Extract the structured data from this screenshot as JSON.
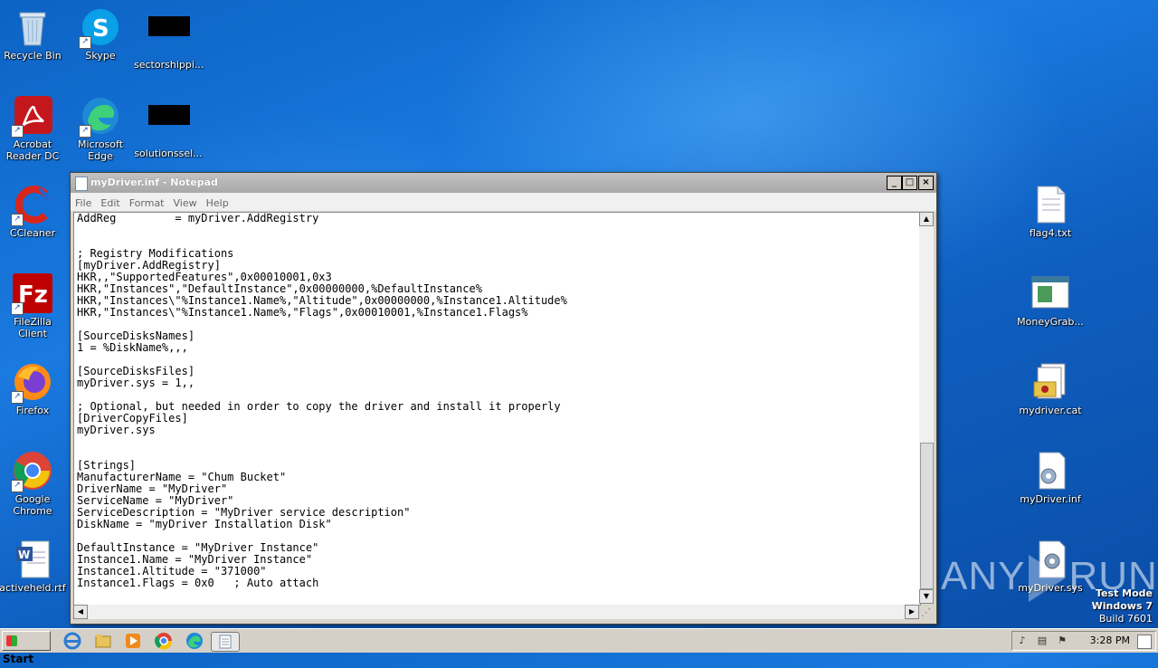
{
  "desktop": {
    "icons": [
      {
        "label": "Recycle Bin"
      },
      {
        "label": "Skype"
      },
      {
        "label": "sectorshippi..."
      },
      {
        "label": "Acrobat Reader DC"
      },
      {
        "label": "Microsoft Edge"
      },
      {
        "label": "solutionssel..."
      },
      {
        "label": "CCleaner"
      },
      {
        "label": "FileZilla Client"
      },
      {
        "label": "Firefox"
      },
      {
        "label": "Google Chrome"
      },
      {
        "label": "activeheld.rtf"
      },
      {
        "label": "flag4.txt"
      },
      {
        "label": "MoneyGrab..."
      },
      {
        "label": "mydriver.cat"
      },
      {
        "label": "myDriver.inf"
      },
      {
        "label": "myDriver.sys"
      }
    ]
  },
  "notepad": {
    "title": "myDriver.inf - Notepad",
    "menu": [
      "File",
      "Edit",
      "Format",
      "View",
      "Help"
    ],
    "content": "AddReg         = myDriver.AddRegistry\n\n\n; Registry Modifications\n[myDriver.AddRegistry]\nHKR,,\"SupportedFeatures\",0x00010001,0x3\nHKR,\"Instances\",\"DefaultInstance\",0x00000000,%DefaultInstance%\nHKR,\"Instances\\\"%Instance1.Name%,\"Altitude\",0x00000000,%Instance1.Altitude%\nHKR,\"Instances\\\"%Instance1.Name%,\"Flags\",0x00010001,%Instance1.Flags%\n\n[SourceDisksNames]\n1 = %DiskName%,,,\n\n[SourceDisksFiles]\nmyDriver.sys = 1,,\n\n; Optional, but needed in order to copy the driver and install it properly\n[DriverCopyFiles]\nmyDriver.sys\n\n\n[Strings]\nManufacturerName = \"Chum Bucket\"\nDriverName = \"MyDriver\"\nServiceName = \"MyDriver\"\nServiceDescription = \"MyDriver service description\"\nDiskName = \"myDriver Installation Disk\"\n\nDefaultInstance = \"MyDriver Instance\"\nInstance1.Name = \"MyDriver Instance\"\nInstance1.Altitude = \"371000\"\nInstance1.Flags = 0x0   ; Auto attach",
    "buttons": {
      "minimize": "_",
      "maximize": "□",
      "close": "×"
    }
  },
  "watermark": {
    "left": "ANY",
    "right": "RUN"
  },
  "testmode": {
    "line1": "Test Mode",
    "line2": "Windows 7",
    "line3": "Build 7601"
  },
  "taskbar": {
    "start": "Start",
    "clock": "3:28 PM"
  }
}
